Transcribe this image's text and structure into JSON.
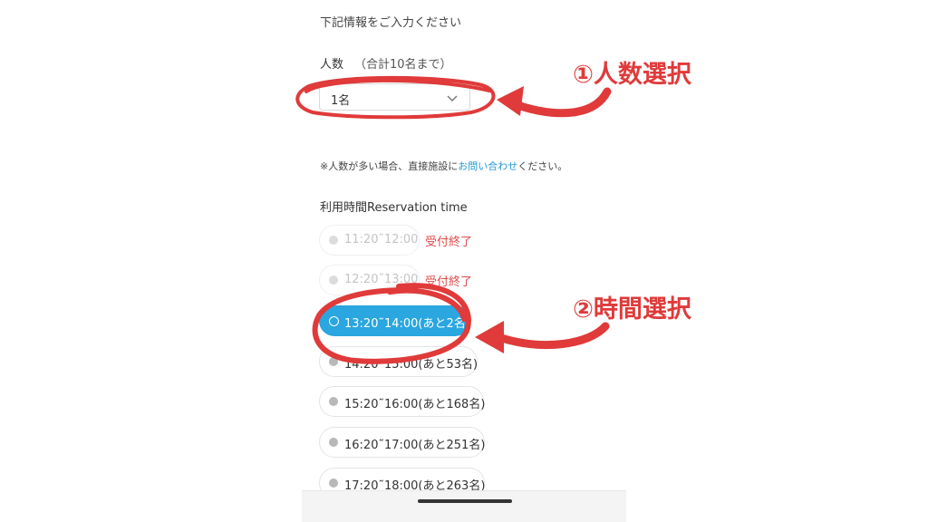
{
  "form": {
    "intro": "下記情報をご入力ください",
    "count_label": "人数",
    "count_note": "（合計10名まで）",
    "count_value": "1名",
    "notice_prefix": "※人数が多い場合、直接施設に",
    "notice_link": "お問い合わせ",
    "notice_suffix": "ください。",
    "time_label": "利用時間Reservation time"
  },
  "slots": [
    {
      "text": "11:20˜12:00",
      "status": "closed",
      "tag": "受付終了"
    },
    {
      "text": "12:20˜13:00",
      "status": "closed",
      "tag": "受付終了"
    },
    {
      "text": "13:20˜14:00(あと2名)",
      "status": "selected"
    },
    {
      "text": "14:20˜15:00(あと53名)",
      "status": "available"
    },
    {
      "text": "15:20˜16:00(あと168名)",
      "status": "available"
    },
    {
      "text": "16:20˜17:00(あと251名)",
      "status": "available"
    },
    {
      "text": "17:20˜18:00(あと263名)",
      "status": "available"
    }
  ],
  "annotations": {
    "step1": "①人数選択",
    "step2": "②時間選択"
  },
  "colors": {
    "accent": "#2aa6e0",
    "annotation": "#e03a3a",
    "closed_text": "#e24a4a",
    "link": "#2196d8"
  }
}
